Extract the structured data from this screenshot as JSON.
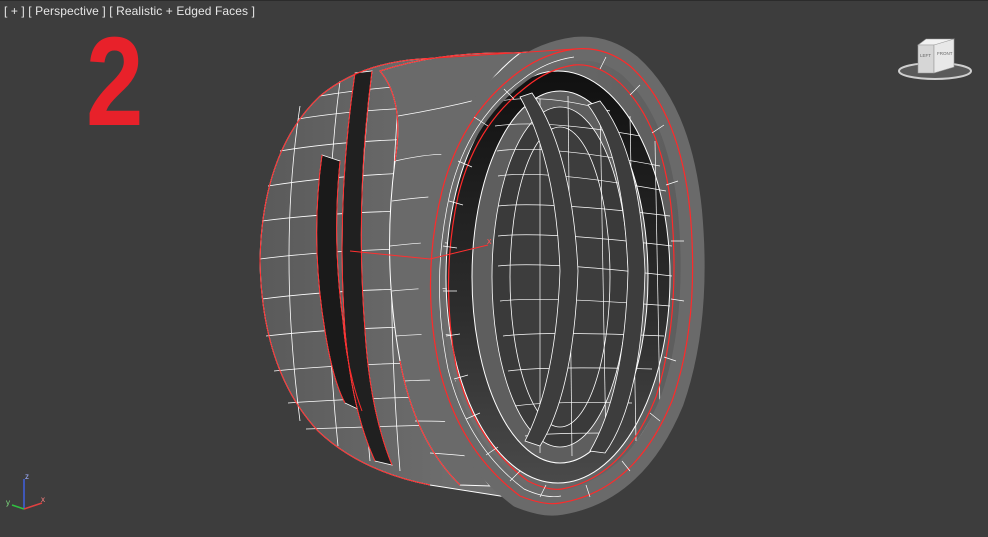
{
  "viewport": {
    "label_plus": "[ + ]",
    "label_view": "[ Perspective ]",
    "label_shading": "[ Realistic + Edged Faces ]",
    "background_color": "#3d3d3d"
  },
  "overlay": {
    "step_number": "2",
    "step_color": "#e8212a"
  },
  "viewcube": {
    "face_left": "LEFT",
    "face_front": "FRONT",
    "icon": "viewcube-icon"
  },
  "gizmo": {
    "x_label": "x"
  },
  "axis_tripod": {
    "x_label": "x",
    "y_label": "y",
    "z_label": "z",
    "x_color": "#e04040",
    "y_color": "#30c040",
    "z_color": "#4060e0"
  },
  "model": {
    "wire_color": "#ffffff",
    "selection_edge_color": "#ff2a2a"
  }
}
